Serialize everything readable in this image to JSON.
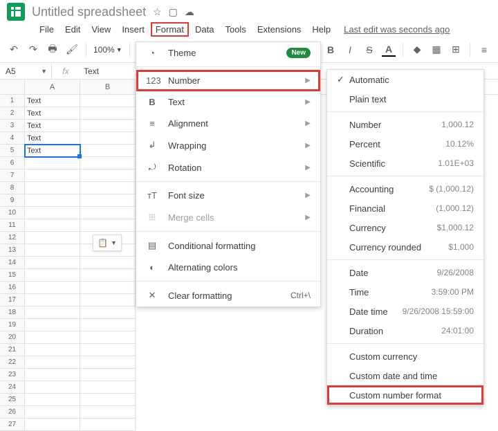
{
  "doc": {
    "title": "Untitled spreadsheet",
    "last_edit": "Last edit was seconds ago"
  },
  "menubar": [
    "File",
    "Edit",
    "View",
    "Insert",
    "Format",
    "Data",
    "Tools",
    "Extensions",
    "Help"
  ],
  "toolbar": {
    "zoom": "100%",
    "bold": "B",
    "italic": "I",
    "strike": "S",
    "textcolor": "A"
  },
  "fx": {
    "namebox": "A5",
    "label": "fx",
    "value": "Text"
  },
  "columns": [
    "A",
    "B"
  ],
  "rows": [
    {
      "n": 1,
      "a": "Text",
      "b": ""
    },
    {
      "n": 2,
      "a": "Text",
      "b": ""
    },
    {
      "n": 3,
      "a": "Text",
      "b": ""
    },
    {
      "n": 4,
      "a": "Text",
      "b": ""
    },
    {
      "n": 5,
      "a": "Text",
      "b": ""
    },
    {
      "n": 6,
      "a": "",
      "b": ""
    },
    {
      "n": 7,
      "a": "",
      "b": ""
    },
    {
      "n": 8,
      "a": "",
      "b": ""
    },
    {
      "n": 9,
      "a": "",
      "b": ""
    },
    {
      "n": 10,
      "a": "",
      "b": ""
    },
    {
      "n": 11,
      "a": "",
      "b": ""
    },
    {
      "n": 12,
      "a": "",
      "b": ""
    },
    {
      "n": 13,
      "a": "",
      "b": ""
    },
    {
      "n": 14,
      "a": "",
      "b": ""
    },
    {
      "n": 15,
      "a": "",
      "b": ""
    },
    {
      "n": 16,
      "a": "",
      "b": ""
    },
    {
      "n": 17,
      "a": "",
      "b": ""
    },
    {
      "n": 18,
      "a": "",
      "b": ""
    },
    {
      "n": 19,
      "a": "",
      "b": ""
    },
    {
      "n": 20,
      "a": "",
      "b": ""
    },
    {
      "n": 21,
      "a": "",
      "b": ""
    },
    {
      "n": 22,
      "a": "",
      "b": ""
    },
    {
      "n": 23,
      "a": "",
      "b": ""
    },
    {
      "n": 24,
      "a": "",
      "b": ""
    },
    {
      "n": 25,
      "a": "",
      "b": ""
    },
    {
      "n": 26,
      "a": "",
      "b": ""
    },
    {
      "n": 27,
      "a": "",
      "b": ""
    }
  ],
  "format_menu": {
    "theme": "Theme",
    "new": "New",
    "number": "Number",
    "text": "Text",
    "alignment": "Alignment",
    "wrapping": "Wrapping",
    "rotation": "Rotation",
    "fontsize": "Font size",
    "merge": "Merge cells",
    "cond": "Conditional formatting",
    "alt": "Alternating colors",
    "clear": "Clear formatting",
    "clear_sc": "Ctrl+\\"
  },
  "number_menu": {
    "automatic": "Automatic",
    "plain": "Plain text",
    "number": {
      "l": "Number",
      "v": "1,000.12"
    },
    "percent": {
      "l": "Percent",
      "v": "10.12%"
    },
    "scientific": {
      "l": "Scientific",
      "v": "1.01E+03"
    },
    "accounting": {
      "l": "Accounting",
      "v": "$ (1,000.12)"
    },
    "financial": {
      "l": "Financial",
      "v": "(1,000.12)"
    },
    "currency": {
      "l": "Currency",
      "v": "$1,000.12"
    },
    "currency_rounded": {
      "l": "Currency rounded",
      "v": "$1,000"
    },
    "date": {
      "l": "Date",
      "v": "9/26/2008"
    },
    "time": {
      "l": "Time",
      "v": "3:59:00 PM"
    },
    "datetime": {
      "l": "Date time",
      "v": "9/26/2008 15:59:00"
    },
    "duration": {
      "l": "Duration",
      "v": "24:01:00"
    },
    "custom_currency": "Custom currency",
    "custom_datetime": "Custom date and time",
    "custom_number": "Custom number format"
  }
}
